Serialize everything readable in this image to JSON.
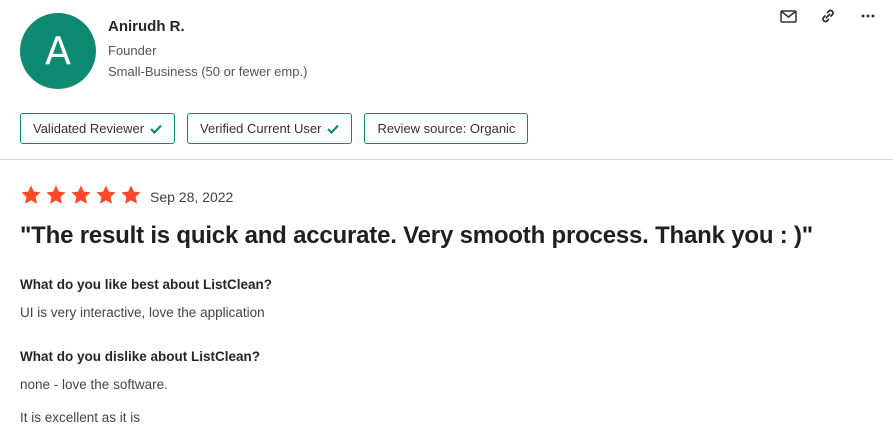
{
  "reviewer": {
    "initial": "A",
    "name": "Anirudh R.",
    "role": "Founder",
    "company_size": "Small-Business (50 or fewer emp.)"
  },
  "badges": [
    {
      "label": "Validated Reviewer",
      "check": true
    },
    {
      "label": "Verified Current User",
      "check": true
    },
    {
      "label": "Review source: Organic",
      "check": false
    }
  ],
  "colors": {
    "accent": "#0e8a73",
    "star": "#ff492c"
  },
  "review": {
    "rating": 5,
    "date": "Sep 28, 2022",
    "title": "\"The result is quick and accurate. Very smooth process. Thank you : )\"",
    "sections": [
      {
        "question": "What do you like best about ListClean?",
        "answers": [
          "UI is very interactive, love the application"
        ]
      },
      {
        "question": "What do you dislike about ListClean?",
        "answers": [
          "none - love the software.",
          "It is excellent as it is"
        ]
      }
    ]
  },
  "icons": [
    "mail-icon",
    "link-icon",
    "more-icon",
    "check-icon",
    "star-icon"
  ]
}
